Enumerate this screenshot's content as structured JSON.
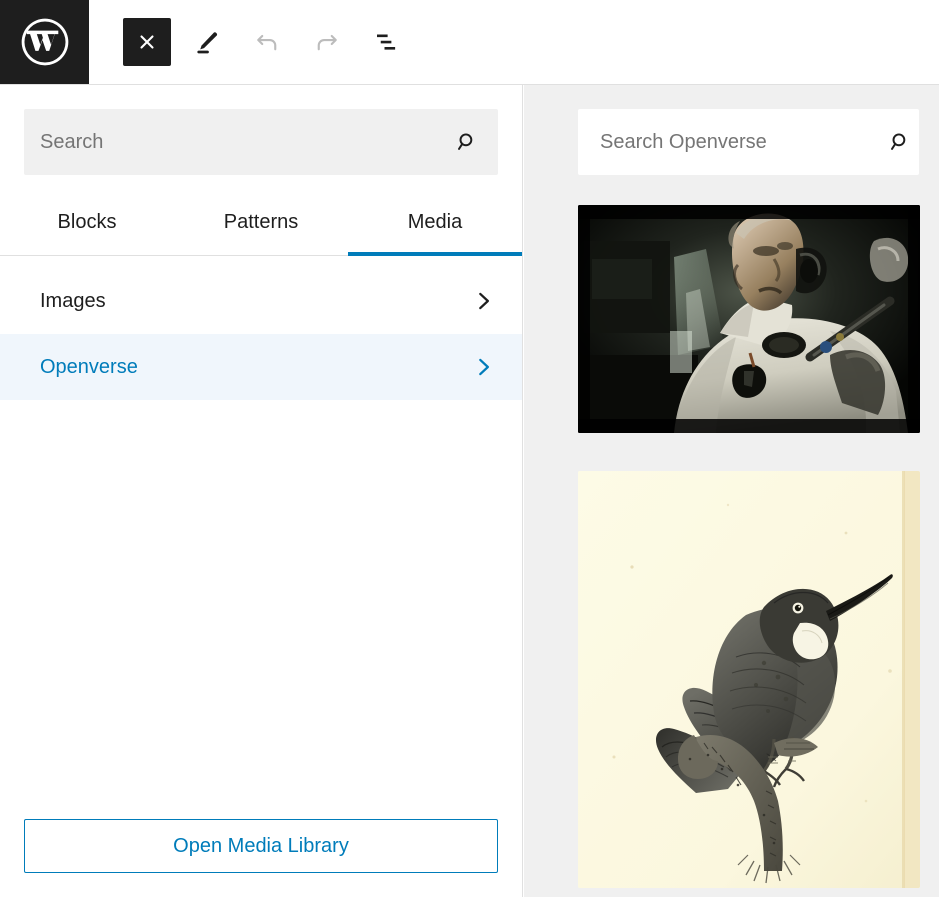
{
  "header": {
    "logo_icon": "wordpress-logo",
    "buttons": [
      {
        "name": "close-inserter-button",
        "icon": "close-icon",
        "label": "Close block inserter"
      },
      {
        "name": "edit-tool-button",
        "icon": "pencil-icon",
        "label": "Edit"
      },
      {
        "name": "undo-button",
        "icon": "undo-arrow-icon",
        "label": "Undo"
      },
      {
        "name": "redo-button",
        "icon": "redo-arrow-icon",
        "label": "Redo"
      },
      {
        "name": "document-overview-button",
        "icon": "list-view-icon",
        "label": "Document Overview"
      }
    ]
  },
  "inserter": {
    "search": {
      "placeholder": "Search",
      "value": "",
      "icon": "search-icon"
    },
    "tabs": [
      {
        "label": "Blocks",
        "active": false
      },
      {
        "label": "Patterns",
        "active": false
      },
      {
        "label": "Media",
        "active": true
      }
    ],
    "media_sources": [
      {
        "label": "Images",
        "selected": false,
        "icon": "chevron-right-icon"
      },
      {
        "label": "Openverse",
        "selected": true,
        "icon": "chevron-right-icon"
      }
    ],
    "media_library_button": "Open Media Library"
  },
  "openverse": {
    "search": {
      "placeholder": "Search Openverse",
      "value": "",
      "icon": "search-icon"
    },
    "results": [
      {
        "name": "openverse-result-astronaut",
        "description": "Dark photograph of an astronaut in a white spacesuit inside a spacecraft cabin"
      },
      {
        "name": "openverse-result-hummingbird",
        "description": "Vintage engraving of a hummingbird perched on a branch on aged cream paper"
      }
    ]
  },
  "colors": {
    "accent_blue": "#007cba",
    "selected_row_bg": "#f0f6fc",
    "panel_gray": "#f0f0f0",
    "dark": "#1e1e1e",
    "border": "#e0e0e0",
    "placeholder": "#757575"
  }
}
